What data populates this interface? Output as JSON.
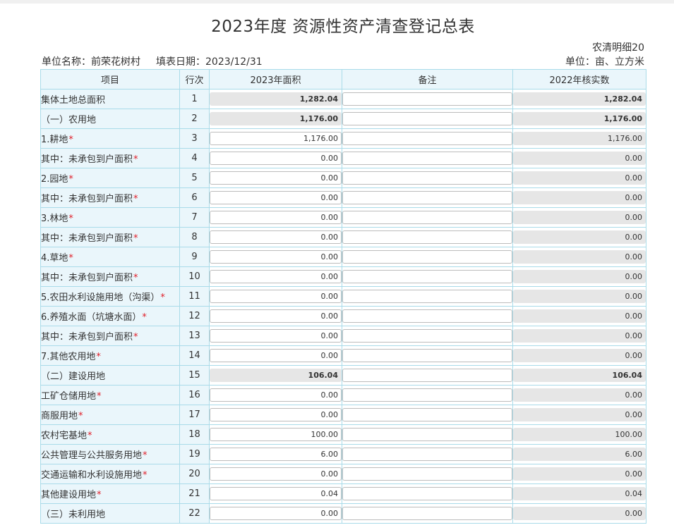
{
  "header": {
    "title": "2023年度 资源性资产清查登记总表",
    "code": "农清明细20",
    "unit_name": "单位名称：前荣花树村",
    "fill_date": "填表日期：2023/12/31",
    "unit_measure": "单位：亩、立方米"
  },
  "table": {
    "columns": [
      "项目",
      "行次",
      "2023年面积",
      "备注",
      "2022年核实数"
    ],
    "rows": [
      {
        "item": "集体土地总面积",
        "required": false,
        "row": "1",
        "area": "1,282.04",
        "area_style": "ro-bold",
        "note": "",
        "prev": "1,282.04",
        "prev_style": "ro-bold"
      },
      {
        "item": "（一）农用地",
        "required": false,
        "row": "2",
        "area": "1,176.00",
        "area_style": "ro-bold",
        "note": "",
        "prev": "1,176.00",
        "prev_style": "ro-bold"
      },
      {
        "item": "1.耕地",
        "required": true,
        "row": "3",
        "area": "1,176.00",
        "area_style": "input",
        "note": "",
        "prev": "1,176.00",
        "prev_style": "ro"
      },
      {
        "item": "其中：未承包到户面积",
        "required": true,
        "row": "4",
        "area": "0.00",
        "area_style": "input",
        "note": "",
        "prev": "0.00",
        "prev_style": "ro"
      },
      {
        "item": "2.园地",
        "required": true,
        "row": "5",
        "area": "0.00",
        "area_style": "input",
        "note": "",
        "prev": "0.00",
        "prev_style": "ro"
      },
      {
        "item": "其中：未承包到户面积",
        "required": true,
        "row": "6",
        "area": "0.00",
        "area_style": "input",
        "note": "",
        "prev": "0.00",
        "prev_style": "ro"
      },
      {
        "item": "3.林地",
        "required": true,
        "row": "7",
        "area": "0.00",
        "area_style": "input",
        "note": "",
        "prev": "0.00",
        "prev_style": "ro"
      },
      {
        "item": "其中：未承包到户面积",
        "required": true,
        "row": "8",
        "area": "0.00",
        "area_style": "input",
        "note": "",
        "prev": "0.00",
        "prev_style": "ro"
      },
      {
        "item": "4.草地",
        "required": true,
        "row": "9",
        "area": "0.00",
        "area_style": "input",
        "note": "",
        "prev": "0.00",
        "prev_style": "ro"
      },
      {
        "item": "其中：未承包到户面积",
        "required": true,
        "row": "10",
        "area": "0.00",
        "area_style": "input",
        "note": "",
        "prev": "0.00",
        "prev_style": "ro"
      },
      {
        "item": "5.农田水利设施用地（沟渠）",
        "required": true,
        "row": "11",
        "area": "0.00",
        "area_style": "input",
        "note": "",
        "prev": "0.00",
        "prev_style": "ro"
      },
      {
        "item": "6.养殖水面（坑塘水面）",
        "required": true,
        "row": "12",
        "area": "0.00",
        "area_style": "input",
        "note": "",
        "prev": "0.00",
        "prev_style": "ro"
      },
      {
        "item": "其中：未承包到户面积",
        "required": true,
        "row": "13",
        "area": "0.00",
        "area_style": "input",
        "note": "",
        "prev": "0.00",
        "prev_style": "ro"
      },
      {
        "item": "7.其他农用地",
        "required": true,
        "row": "14",
        "area": "0.00",
        "area_style": "input",
        "note": "",
        "prev": "0.00",
        "prev_style": "ro"
      },
      {
        "item": "（二）建设用地",
        "required": false,
        "row": "15",
        "area": "106.04",
        "area_style": "ro-bold",
        "note": "",
        "prev": "106.04",
        "prev_style": "ro-bold"
      },
      {
        "item": "工矿仓储用地",
        "required": true,
        "row": "16",
        "area": "0.00",
        "area_style": "input",
        "note": "",
        "prev": "0.00",
        "prev_style": "ro"
      },
      {
        "item": "商服用地",
        "required": true,
        "row": "17",
        "area": "0.00",
        "area_style": "input",
        "note": "",
        "prev": "0.00",
        "prev_style": "ro"
      },
      {
        "item": "农村宅基地",
        "required": true,
        "row": "18",
        "area": "100.00",
        "area_style": "input",
        "note": "",
        "prev": "100.00",
        "prev_style": "ro"
      },
      {
        "item": "公共管理与公共服务用地",
        "required": true,
        "row": "19",
        "area": "6.00",
        "area_style": "input",
        "note": "",
        "prev": "6.00",
        "prev_style": "ro"
      },
      {
        "item": "交通运输和水利设施用地",
        "required": true,
        "row": "20",
        "area": "0.00",
        "area_style": "input",
        "note": "",
        "prev": "0.00",
        "prev_style": "ro"
      },
      {
        "item": "其他建设用地",
        "required": true,
        "row": "21",
        "area": "0.04",
        "area_style": "input",
        "note": "",
        "prev": "0.04",
        "prev_style": "ro"
      },
      {
        "item": "（三）未利用地",
        "required": false,
        "row": "22",
        "area": "0.00",
        "area_style": "input",
        "note": "",
        "prev": "0.00",
        "prev_style": "ro"
      }
    ]
  },
  "colors": {
    "header_bg": "#eaf6fb",
    "border": "#a9dbe9",
    "readonly_bg": "#e6e6e6",
    "required_mark": "#e0202a"
  }
}
